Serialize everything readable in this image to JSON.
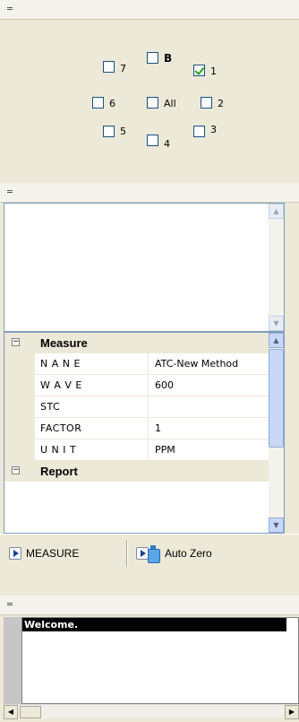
{
  "channels": {
    "items": [
      {
        "id": "7",
        "label": "7",
        "checked": false
      },
      {
        "id": "B",
        "label": "B",
        "checked": false
      },
      {
        "id": "1",
        "label": "1",
        "checked": true
      },
      {
        "id": "6",
        "label": "6",
        "checked": false
      },
      {
        "id": "All",
        "label": "All",
        "checked": false
      },
      {
        "id": "2",
        "label": "2",
        "checked": false
      },
      {
        "id": "5",
        "label": "5",
        "checked": false
      },
      {
        "id": "4",
        "label": "4",
        "checked": false
      },
      {
        "id": "3",
        "label": "3",
        "checked": false
      }
    ]
  },
  "properties": {
    "measure_label": "Measure",
    "report_label": "Report",
    "rows": [
      {
        "name": "N A N E",
        "value": "ATC-New Method"
      },
      {
        "name": "W A V E",
        "value": "600"
      },
      {
        "name": "STC",
        "value": ""
      },
      {
        "name": "FACTOR",
        "value": "1"
      },
      {
        "name": "U N I T",
        "value": "PPM"
      }
    ]
  },
  "toolbar": {
    "measure_label": "MEASURE",
    "auto_zero_label": "Auto Zero"
  },
  "log": {
    "header": "Welcome."
  }
}
